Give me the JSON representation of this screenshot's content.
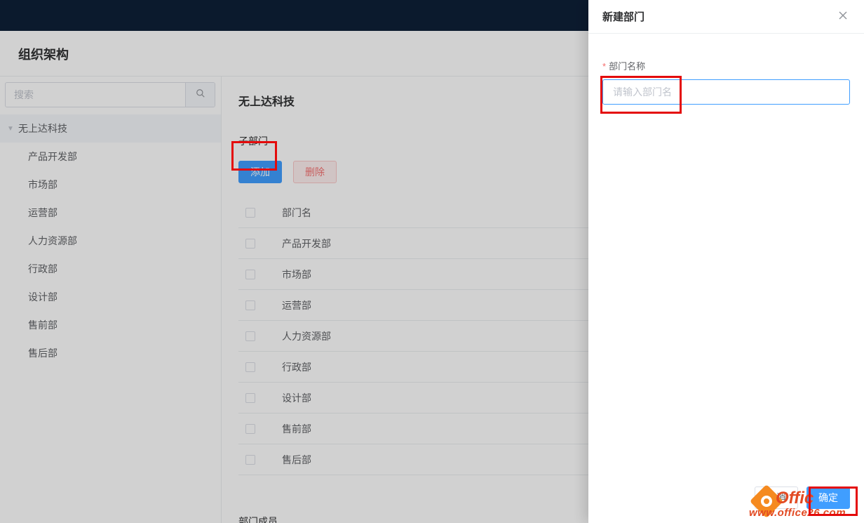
{
  "page": {
    "title": "组织架构"
  },
  "sidebar": {
    "search_placeholder": "搜索",
    "root_label": "无上达科技",
    "children": [
      {
        "label": "产品开发部"
      },
      {
        "label": "市场部"
      },
      {
        "label": "运营部"
      },
      {
        "label": "人力资源部"
      },
      {
        "label": "行政部"
      },
      {
        "label": "设计部"
      },
      {
        "label": "售前部"
      },
      {
        "label": "售后部"
      }
    ]
  },
  "content": {
    "title": "无上达科技",
    "sub_label": "子部门",
    "add_btn": "添加",
    "del_btn": "删除",
    "header_name": "部门名",
    "rows": [
      {
        "name": "产品开发部"
      },
      {
        "name": "市场部"
      },
      {
        "name": "运营部"
      },
      {
        "name": "人力资源部"
      },
      {
        "name": "行政部"
      },
      {
        "name": "设计部"
      },
      {
        "name": "售前部"
      },
      {
        "name": "售后部"
      }
    ],
    "members_label": "部门成员"
  },
  "drawer": {
    "title": "新建部门",
    "field_label": "部门名称",
    "placeholder": "请输入部门名",
    "value": "",
    "cancel": "取消",
    "confirm": "确定"
  },
  "watermark": {
    "line1": "Offic",
    "line2": "www.office26.com"
  }
}
